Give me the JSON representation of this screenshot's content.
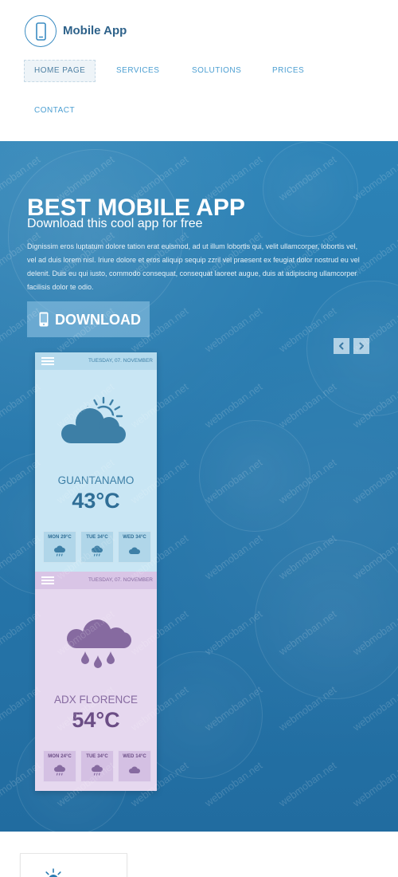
{
  "brand": {
    "name": "Mobile App",
    "logo_icon": "phone-icon"
  },
  "nav": {
    "items": [
      {
        "label": "HOME PAGE",
        "active": true
      },
      {
        "label": "SERVICES",
        "active": false
      },
      {
        "label": "SOLUTIONS",
        "active": false
      },
      {
        "label": "PRICES",
        "active": false
      },
      {
        "label": "CONTACT",
        "active": false
      }
    ]
  },
  "hero": {
    "title": "BEST MOBILE APP",
    "subtitle": "Download this cool app for free",
    "body": "Dignissim eros luptatum dolore tation erat euismod, ad ut illum lobortis qui, velit ullamcorper, lobortis vel, vel ad duis lorem nisl. Iriure dolore et eros aliquip sequip zzril vel praesent ex feugiat dolor nostrud eu vel delenit. Duis eu qui iusto, commodo consequat, consequat laoreet augue, duis at adipiscing ullamcorper facilisis dolor te odio.",
    "download_button": {
      "label": "DOWNLOAD",
      "icon": "phone-icon"
    },
    "slider": {
      "prev_icon": "chevron-left-icon",
      "next_icon": "chevron-right-icon"
    }
  },
  "weather_widgets": [
    {
      "menu_icon": "hamburger-icon",
      "date": "TUESDAY, 07. NOVEMBER",
      "city": "GUANTANAMO",
      "temperature": "43°C",
      "icon": "sun-cloud-icon",
      "theme": {
        "bg": "#c9e6f4",
        "header": "#b4daed",
        "box": "#b0d6e9",
        "accent": "#3d7fa6",
        "text": "#2f6e96"
      },
      "forecast": [
        {
          "day": "MON",
          "temp": "29°C",
          "icon": "rain-cloud-icon"
        },
        {
          "day": "TUE",
          "temp": "34°C",
          "icon": "rain-cloud-icon"
        },
        {
          "day": "WED",
          "temp": "34°C",
          "icon": "cloud-icon"
        }
      ]
    },
    {
      "menu_icon": "hamburger-icon",
      "date": "TUESDAY, 07. NOVEMBER",
      "city": "ADX FLORENCE",
      "temperature": "54°C",
      "icon": "rain-drops-cloud-icon",
      "theme": {
        "bg": "#e6d8ef",
        "header": "#d9c5e6",
        "box": "#d4c0e3",
        "accent": "#866aa0",
        "text": "#6b4d85"
      },
      "forecast": [
        {
          "day": "MON",
          "temp": "24°C",
          "icon": "rain-cloud-icon"
        },
        {
          "day": "TUE",
          "temp": "34°C",
          "icon": "rain-cloud-icon"
        },
        {
          "day": "WED",
          "temp": "14°C",
          "icon": "cloud-icon"
        }
      ]
    }
  ],
  "feature_card": {
    "icon": "sun-icon"
  },
  "watermark": "webmoban.net",
  "colors": {
    "brand_text": "#2e628a",
    "nav_text": "#4c9fd2",
    "hero_bg": "#2879ad",
    "hero_text": "#ffffff",
    "download_button_bg": "#62a5cf"
  }
}
